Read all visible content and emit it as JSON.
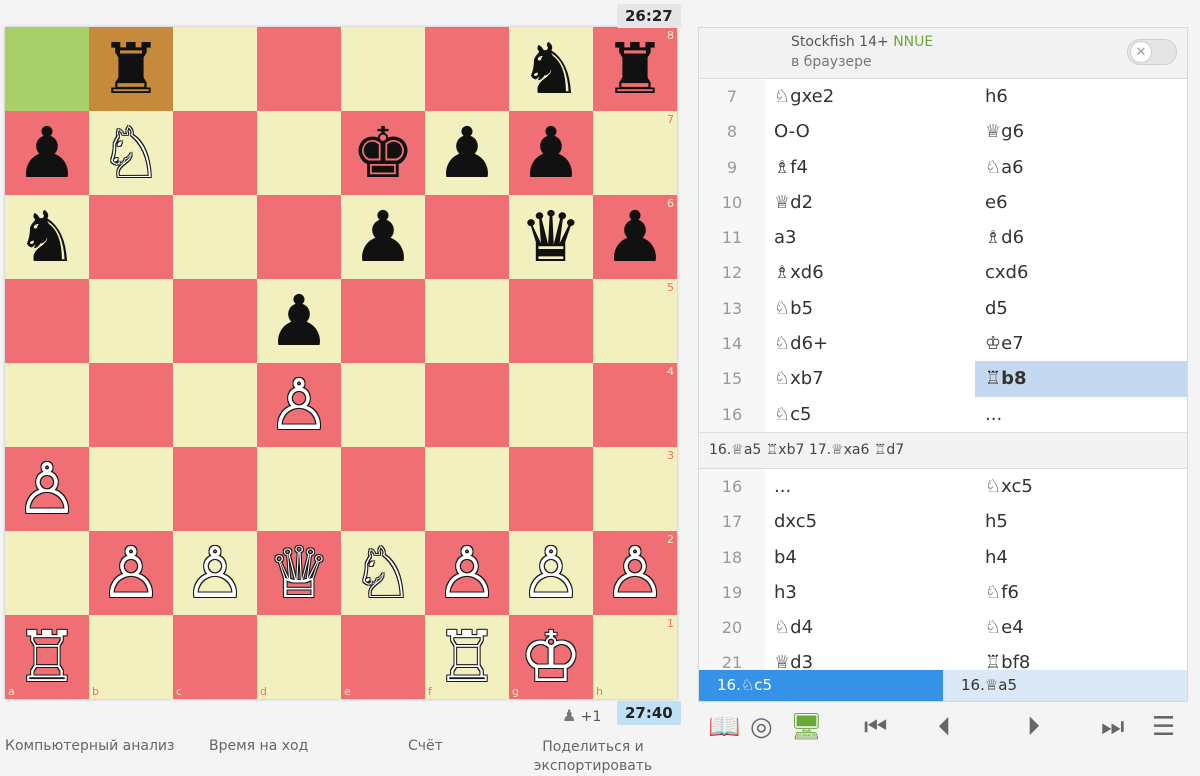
{
  "board": {
    "ranks": [
      [
        {
          "sq": "a8",
          "p": ""
        },
        {
          "sq": "b8",
          "p": "♜",
          "c": "b"
        },
        {
          "sq": "c8",
          "p": ""
        },
        {
          "sq": "d8",
          "p": ""
        },
        {
          "sq": "e8",
          "p": ""
        },
        {
          "sq": "f8",
          "p": ""
        },
        {
          "sq": "g8",
          "p": "♞",
          "c": "b"
        },
        {
          "sq": "h8",
          "p": "♜",
          "c": "b"
        }
      ],
      [
        {
          "sq": "a7",
          "p": "♟",
          "c": "b"
        },
        {
          "sq": "b7",
          "p": "♘",
          "c": "w"
        },
        {
          "sq": "c7",
          "p": ""
        },
        {
          "sq": "d7",
          "p": ""
        },
        {
          "sq": "e7",
          "p": "♚",
          "c": "b"
        },
        {
          "sq": "f7",
          "p": "♟",
          "c": "b"
        },
        {
          "sq": "g7",
          "p": "♟",
          "c": "b"
        },
        {
          "sq": "h7",
          "p": ""
        }
      ],
      [
        {
          "sq": "a6",
          "p": "♞",
          "c": "b"
        },
        {
          "sq": "b6",
          "p": ""
        },
        {
          "sq": "c6",
          "p": ""
        },
        {
          "sq": "d6",
          "p": ""
        },
        {
          "sq": "e6",
          "p": "♟",
          "c": "b"
        },
        {
          "sq": "f6",
          "p": ""
        },
        {
          "sq": "g6",
          "p": "♛",
          "c": "b"
        },
        {
          "sq": "h6",
          "p": "♟",
          "c": "b"
        }
      ],
      [
        {
          "sq": "a5",
          "p": ""
        },
        {
          "sq": "b5",
          "p": ""
        },
        {
          "sq": "c5",
          "p": ""
        },
        {
          "sq": "d5",
          "p": "♟",
          "c": "b"
        },
        {
          "sq": "e5",
          "p": ""
        },
        {
          "sq": "f5",
          "p": ""
        },
        {
          "sq": "g5",
          "p": ""
        },
        {
          "sq": "h5",
          "p": ""
        }
      ],
      [
        {
          "sq": "a4",
          "p": ""
        },
        {
          "sq": "b4",
          "p": ""
        },
        {
          "sq": "c4",
          "p": ""
        },
        {
          "sq": "d4",
          "p": "♙",
          "c": "w"
        },
        {
          "sq": "e4",
          "p": ""
        },
        {
          "sq": "f4",
          "p": ""
        },
        {
          "sq": "g4",
          "p": ""
        },
        {
          "sq": "h4",
          "p": ""
        }
      ],
      [
        {
          "sq": "a3",
          "p": "♙",
          "c": "w"
        },
        {
          "sq": "b3",
          "p": ""
        },
        {
          "sq": "c3",
          "p": ""
        },
        {
          "sq": "d3",
          "p": ""
        },
        {
          "sq": "e3",
          "p": ""
        },
        {
          "sq": "f3",
          "p": ""
        },
        {
          "sq": "g3",
          "p": ""
        },
        {
          "sq": "h3",
          "p": ""
        }
      ],
      [
        {
          "sq": "a2",
          "p": ""
        },
        {
          "sq": "b2",
          "p": "♙",
          "c": "w"
        },
        {
          "sq": "c2",
          "p": "♙",
          "c": "w"
        },
        {
          "sq": "d2",
          "p": "♕",
          "c": "w"
        },
        {
          "sq": "e2",
          "p": "♘",
          "c": "w"
        },
        {
          "sq": "f2",
          "p": "♙",
          "c": "w"
        },
        {
          "sq": "g2",
          "p": "♙",
          "c": "w"
        },
        {
          "sq": "h2",
          "p": "♙",
          "c": "w"
        }
      ],
      [
        {
          "sq": "a1",
          "p": "♖",
          "c": "w"
        },
        {
          "sq": "b1",
          "p": ""
        },
        {
          "sq": "c1",
          "p": ""
        },
        {
          "sq": "d1",
          "p": ""
        },
        {
          "sq": "e1",
          "p": ""
        },
        {
          "sq": "f1",
          "p": "♖",
          "c": "w"
        },
        {
          "sq": "g1",
          "p": "♔",
          "c": "w"
        },
        {
          "sq": "h1",
          "p": ""
        }
      ]
    ],
    "last_move": {
      "from": "a8",
      "to": "b8"
    },
    "rank_labels": [
      "8",
      "7",
      "6",
      "5",
      "4",
      "3",
      "2",
      "1"
    ],
    "file_labels": [
      "a",
      "b",
      "c",
      "d",
      "e",
      "f",
      "g",
      "h"
    ],
    "colors": {
      "light": "#f3f0c0",
      "dark": "#ef6f74",
      "last_from": "#a9cf6b",
      "last_to": "#c58a3c"
    }
  },
  "clocks": {
    "top": "26:27",
    "bottom": "27:40"
  },
  "material": "+1",
  "bottom_links": {
    "analysis": "Компьютерный анализ",
    "time": "Время на ход",
    "score": "Счёт",
    "share": "Поделиться и экспортировать"
  },
  "engine": {
    "name": "Stockfish 14+",
    "nnue": "NNUE",
    "subtitle": "в браузере",
    "enabled": false
  },
  "moves_top": [
    {
      "n": "7",
      "w": "♘gxe2",
      "b": "h6"
    },
    {
      "n": "8",
      "w": "O-O",
      "b": "♕g6"
    },
    {
      "n": "9",
      "w": "♗f4",
      "b": "♘a6"
    },
    {
      "n": "10",
      "w": "♕d2",
      "b": "e6"
    },
    {
      "n": "11",
      "w": "a3",
      "b": "♗d6"
    },
    {
      "n": "12",
      "w": "♗xd6",
      "b": "cxd6"
    },
    {
      "n": "13",
      "w": "♘b5",
      "b": "d5"
    },
    {
      "n": "14",
      "w": "♘d6+",
      "b": "♔e7"
    },
    {
      "n": "15",
      "w": "♘xb7",
      "b": "♖b8",
      "active": true
    },
    {
      "n": "16",
      "w": "♘c5",
      "b": "..."
    }
  ],
  "variation": "16.♕a5 ♖xb7 17.♕xa6 ♖d7",
  "moves_bottom": [
    {
      "n": "16",
      "w": "...",
      "b": "♘xc5"
    },
    {
      "n": "17",
      "w": "dxc5",
      "b": "h5"
    },
    {
      "n": "18",
      "w": "b4",
      "b": "h4"
    },
    {
      "n": "19",
      "w": "h3",
      "b": "♘f6"
    },
    {
      "n": "20",
      "w": "♘d4",
      "b": "♘e4"
    },
    {
      "n": "21",
      "w": "♕d3",
      "b": "♖bf8"
    }
  ],
  "crumbs": {
    "first": "16.♘c5",
    "second": "16.♕a5"
  },
  "controls": {
    "book": "📖",
    "target": "◎",
    "monitor": "🖥",
    "first": "⏮",
    "prev": "⏴",
    "next": "⏵",
    "last": "⏭",
    "menu": "☰"
  }
}
